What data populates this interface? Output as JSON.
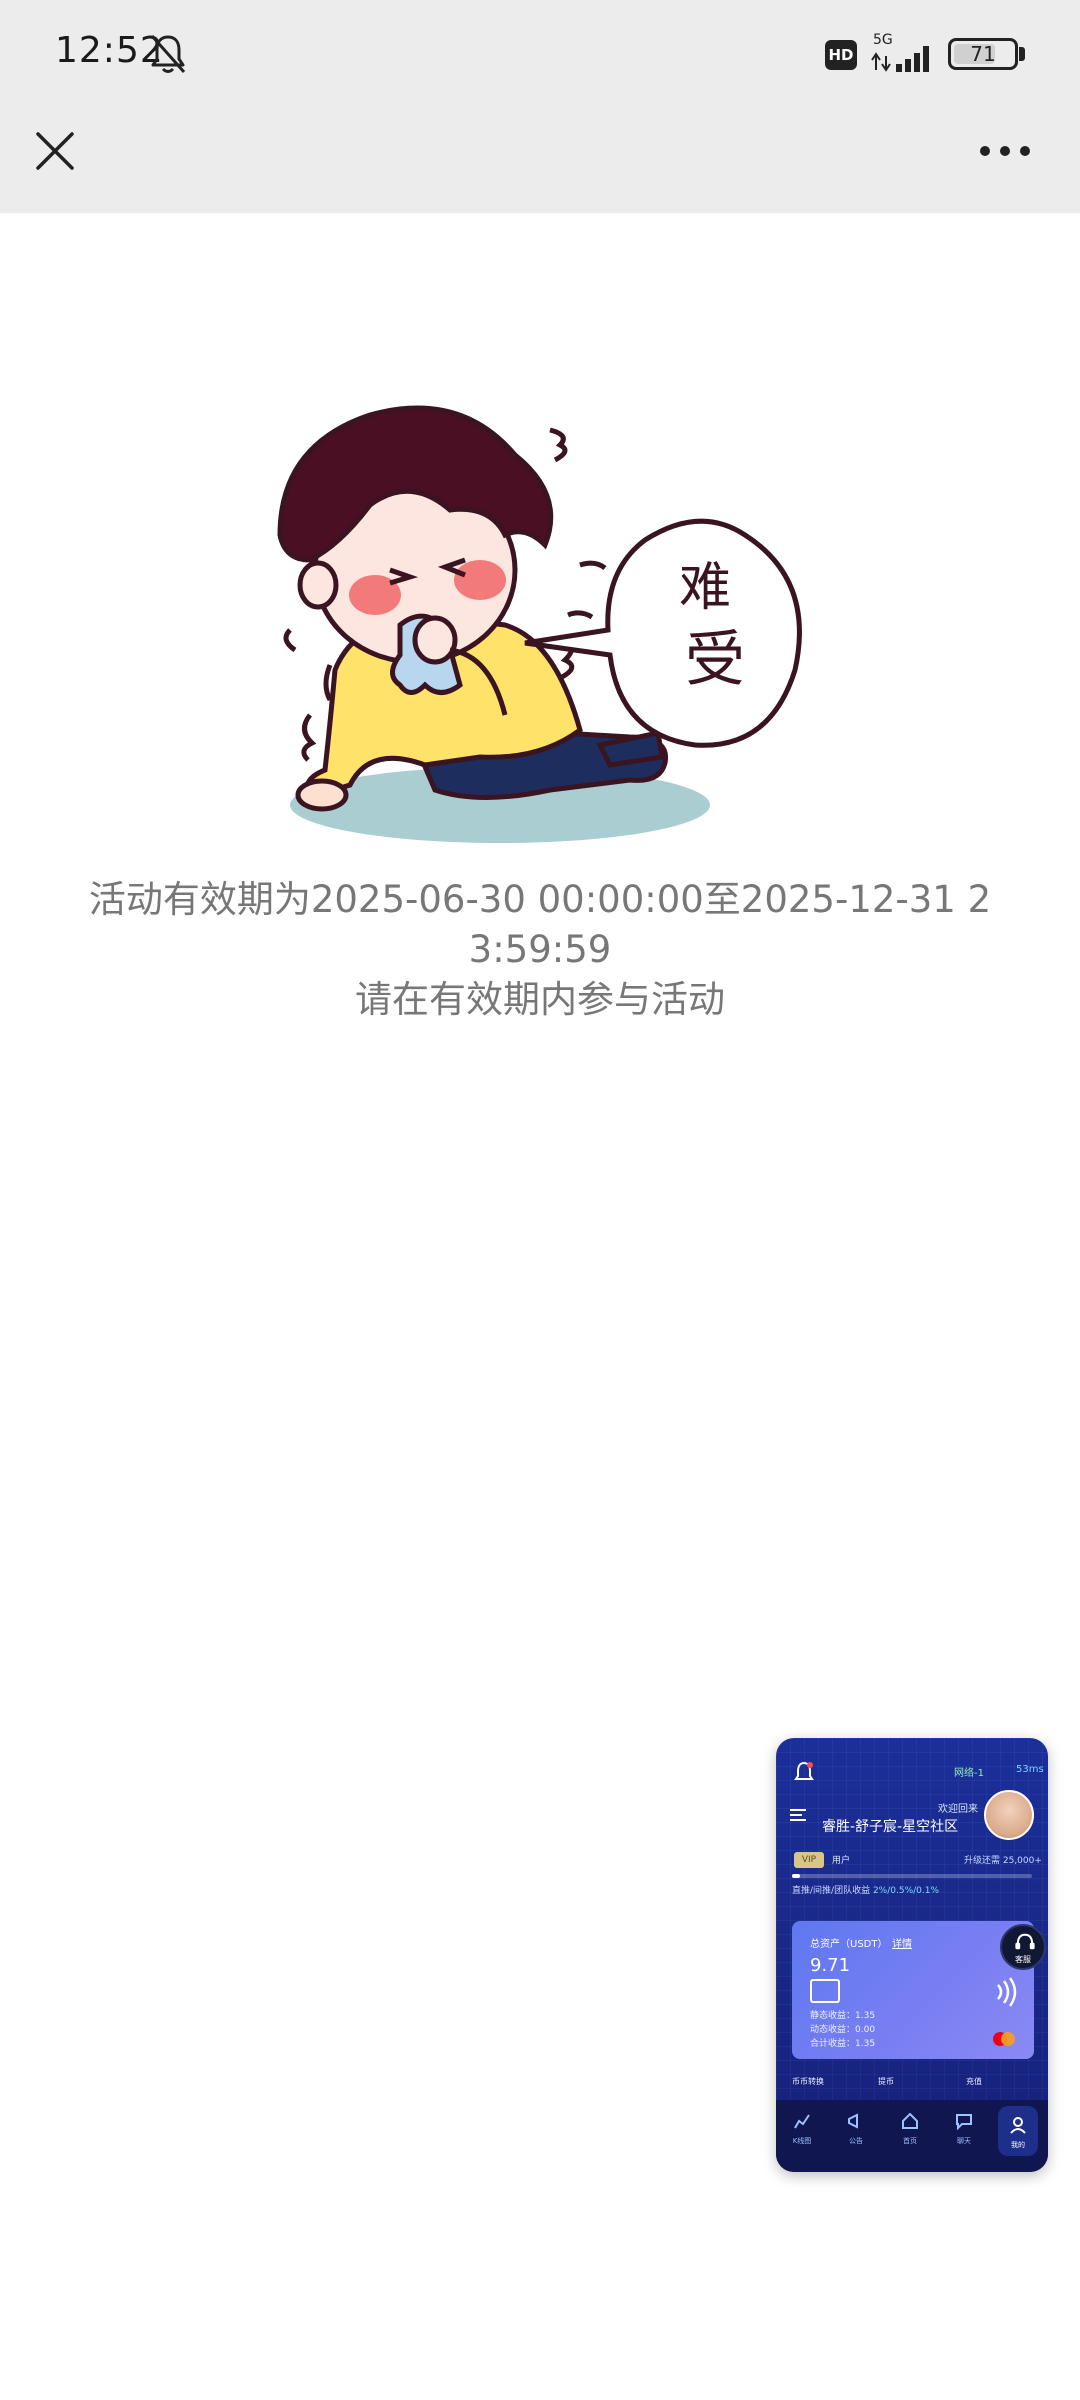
{
  "status_bar": {
    "time": "12:52",
    "hd": "HD",
    "network": "5G",
    "battery": "71",
    "battery_level": 0.71
  },
  "main": {
    "message_line1": "活动有效期为2025-06-30 00:00:00至2025-12-31 2",
    "message_line2": "3:59:59",
    "message_line3": "请在有效期内参与活动",
    "illustration_text": "难受"
  },
  "mini_window": {
    "network": "网络-1",
    "network_extra": "53ms",
    "welcome": "欢迎回来",
    "title": "睿胜-舒子宸-星空社区",
    "vip_badge": "VIP",
    "vip_label": "用户",
    "upgrade": "升级还需 25,000+",
    "ratio_label": "直推/间推/团队收益",
    "ratio_value": "2%/0.5%/0.1%",
    "card_title": "总资产（USDT）",
    "card_link": "详情",
    "card_value": "9.71",
    "line1": "静态收益：1.35",
    "line2": "动态收益：0.00",
    "line3": "合计收益：1.35",
    "service": "客服",
    "quick": [
      "币币转换",
      "提币",
      "充值"
    ],
    "tabs": [
      "K线图",
      "公告",
      "首页",
      "聊天",
      "我的"
    ]
  }
}
